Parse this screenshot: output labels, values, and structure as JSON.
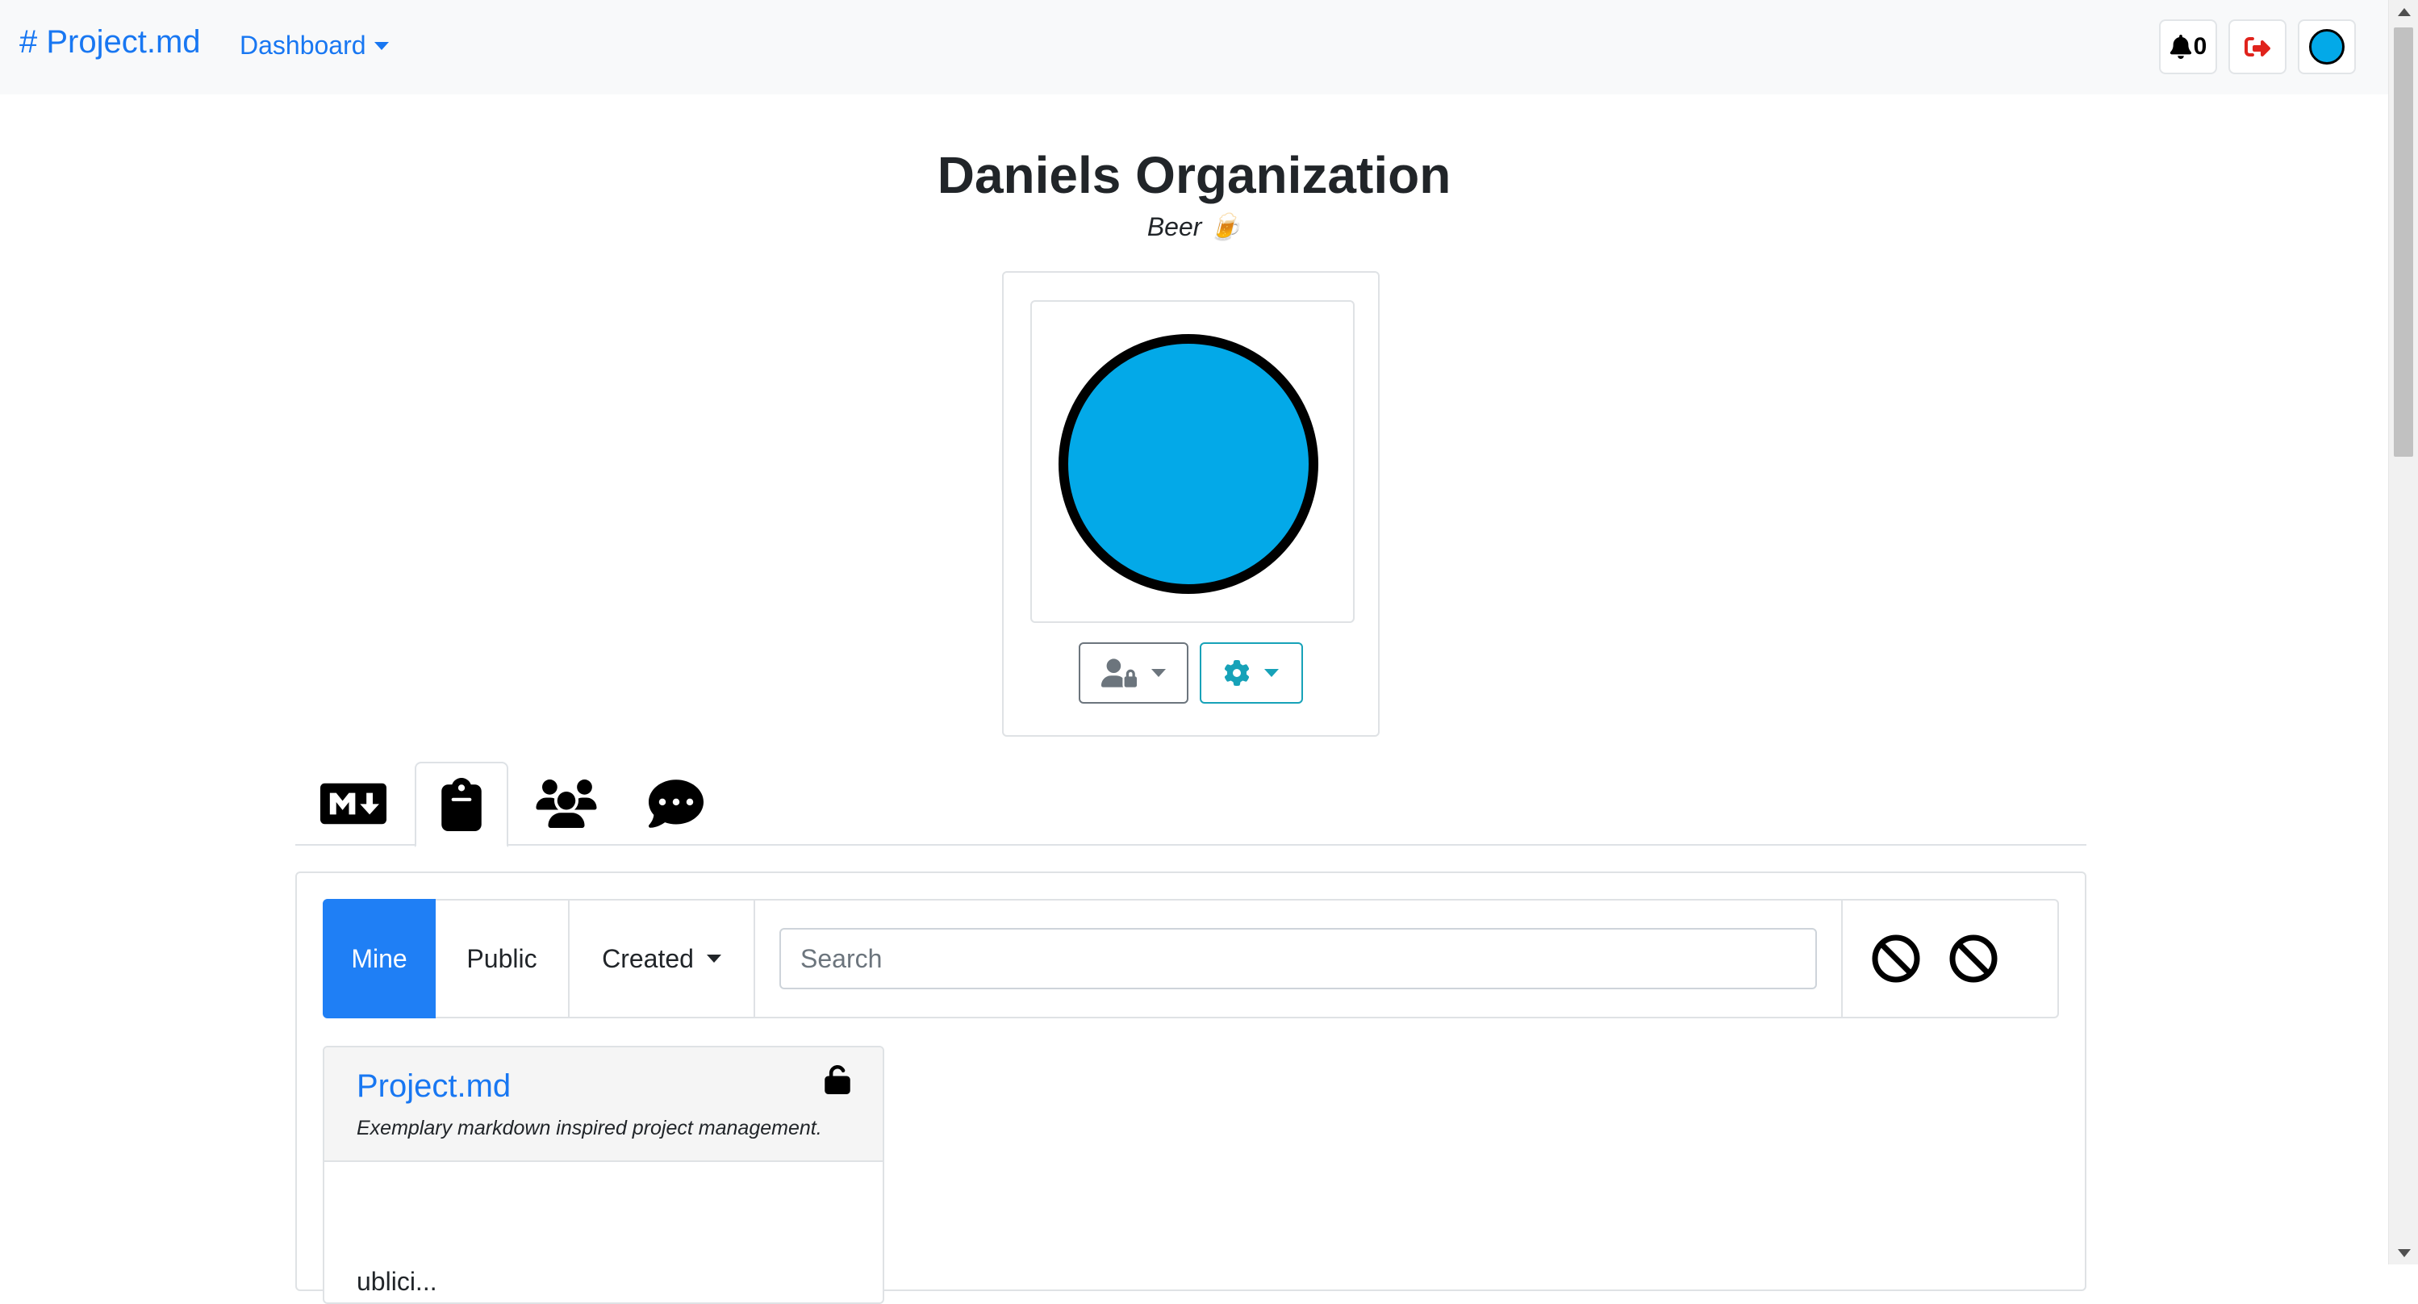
{
  "navbar": {
    "brand": "# Project.md",
    "dashboard_label": "Dashboard",
    "notification_count": "0",
    "icons": [
      "bell-icon",
      "sign-out-icon",
      "avatar"
    ],
    "colors": {
      "link": "#1877f2",
      "logout": "#e0231c",
      "avatar": "#03a9e8"
    }
  },
  "org": {
    "title": "Daniels Organization",
    "subtitle": "Beer 🍺"
  },
  "profile_card": {
    "buttons": [
      {
        "icon": "user-shield-icon",
        "dropdown": true
      },
      {
        "icon": "gear-icon",
        "dropdown": true
      }
    ]
  },
  "tabs": [
    {
      "icon": "markdown-icon",
      "active": false
    },
    {
      "icon": "clipboard-icon",
      "active": true
    },
    {
      "icon": "users-icon",
      "active": false
    },
    {
      "icon": "comment-dots-icon",
      "active": false
    }
  ],
  "filters": {
    "mine_label": "Mine",
    "public_label": "Public",
    "created_label": "Created",
    "search_placeholder": "Search",
    "search_value": "",
    "active_color": "#1f7ff5"
  },
  "projects": [
    {
      "name": "Project.md",
      "description": "Exemplary markdown inspired project management.",
      "lock": "unlocked",
      "body_text": "ublici..."
    }
  ]
}
